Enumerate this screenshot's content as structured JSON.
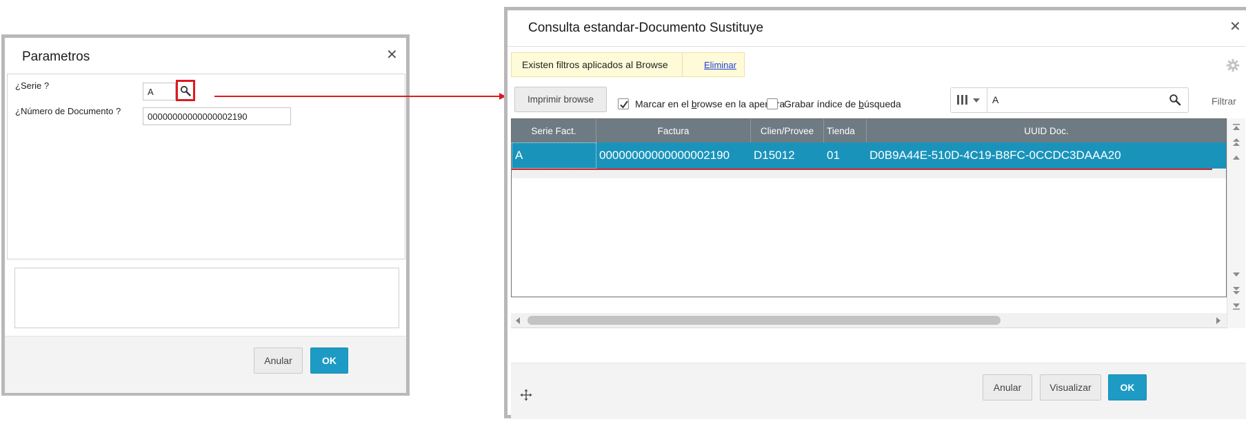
{
  "left_dialog": {
    "title": "Parametros",
    "close_icon": "close-icon",
    "fields": [
      {
        "label": "¿Serie ?",
        "value": "A"
      },
      {
        "label": "¿Número de Documento ?",
        "value": "00000000000000002190"
      }
    ],
    "lens_icon": "search-icon",
    "buttons": {
      "cancel": "Anular",
      "ok": "OK"
    }
  },
  "right_dialog": {
    "title": "Consulta estandar-Documento Sustituye",
    "close_icon": "close-icon",
    "filter_notice": {
      "text": "Existen filtros aplicados al Browse",
      "link": "Eliminar"
    },
    "settings_icon": "gear-icon",
    "print_button": "Imprimir browse",
    "checkboxes": [
      {
        "pre": "Marcar en el ",
        "ul": "b",
        "post": "rowse en la apertura",
        "checked": true
      },
      {
        "pre": "Grabar índice de ",
        "ul": "b",
        "post": "úsqueda",
        "checked": false
      }
    ],
    "search": {
      "value": "A",
      "columns_icon": "columns-icon"
    },
    "filter_label": "Filtrar",
    "grid": {
      "columns": [
        "Serie Fact.",
        "Factura",
        "Clien/Provee",
        "Tienda",
        "UUID Doc."
      ],
      "rows": [
        [
          "A",
          "00000000000000002190",
          "D15012",
          "01",
          "D0B9A44E-510D-4C19-B8FC-0CCDC3DAAA20"
        ]
      ]
    },
    "buttons": {
      "cancel": "Anular",
      "view": "Visualizar",
      "ok": "OK"
    },
    "move_icon": "move-icon"
  },
  "colors": {
    "accent": "#1d9bc4",
    "selected_row": "#1a93bb",
    "grid_header": "#6e7b82",
    "highlight_red": "#e0181e",
    "notice_bg": "#fffbd9"
  }
}
